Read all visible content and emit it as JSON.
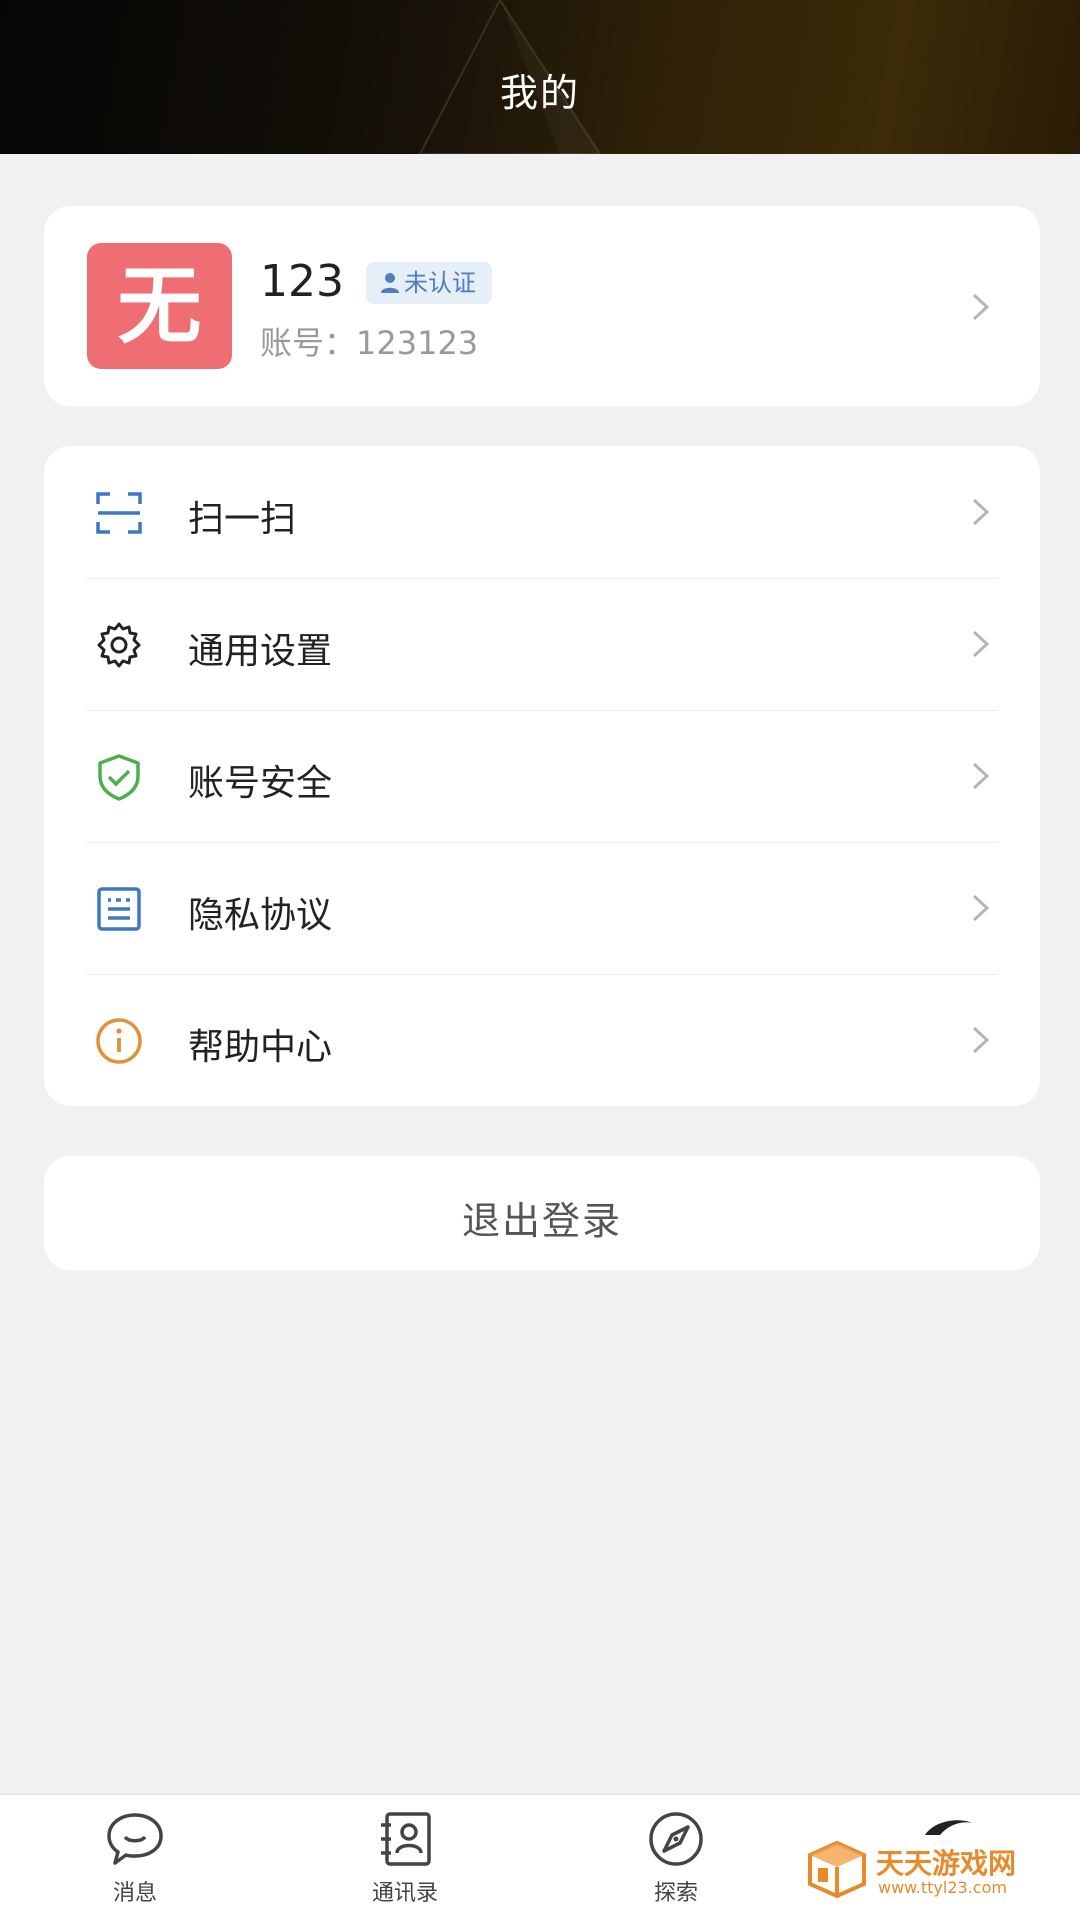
{
  "header": {
    "title": "我的"
  },
  "profile": {
    "avatar_char": "无",
    "username": "123",
    "badge": "未认证",
    "account": "账号：123123"
  },
  "menu": [
    {
      "label": "扫一扫",
      "icon": "scan-icon"
    },
    {
      "label": "通用设置",
      "icon": "gear-icon"
    },
    {
      "label": "账号安全",
      "icon": "shield-check-icon"
    },
    {
      "label": "隐私协议",
      "icon": "document-icon"
    },
    {
      "label": "帮助中心",
      "icon": "info-icon"
    }
  ],
  "logout": {
    "label": "退出登录"
  },
  "tabbar": [
    {
      "label": "消息",
      "icon": "chat-bubble-icon"
    },
    {
      "label": "通讯录",
      "icon": "contacts-book-icon"
    },
    {
      "label": "探索",
      "icon": "compass-icon"
    }
  ],
  "watermark": {
    "text": "天天游戏网",
    "url": "www.ttyl23.com"
  },
  "colors": {
    "avatar_bg": "#ef6e73",
    "badge_bg": "#e6eef8",
    "badge_text": "#4f7ec0",
    "scan_icon": "#3e78c4",
    "shield_icon": "#4caf50",
    "document_icon": "#3e78c4",
    "info_icon": "#e0923a",
    "watermark": "#e8892a"
  }
}
